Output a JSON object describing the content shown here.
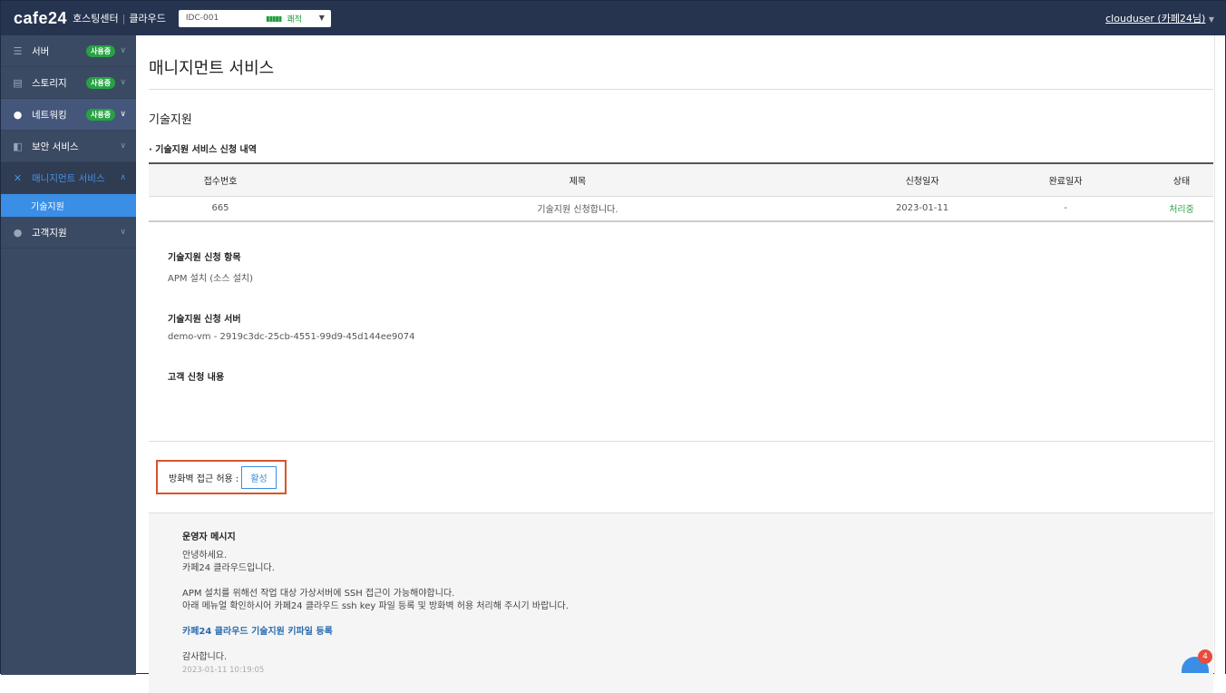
{
  "header": {
    "logo": "cafe24",
    "logo_sub1": "호스팅센터",
    "logo_sub2": "클라우드",
    "idc": {
      "value": "IDC-001",
      "status": "쾌적"
    },
    "user": "clouduser (카페24님)"
  },
  "sidebar": {
    "items": [
      {
        "label": "서버",
        "badge": "사용중",
        "icon": "server-icon"
      },
      {
        "label": "스토리지",
        "badge": "사용중",
        "icon": "storage-icon"
      },
      {
        "label": "네트워킹",
        "badge": "사용중",
        "icon": "globe-icon"
      },
      {
        "label": "보안 서비스",
        "icon": "shield-icon"
      },
      {
        "label": "매니지먼트 서비스",
        "icon": "tools-icon"
      },
      {
        "label": "고객지원",
        "icon": "user-icon"
      }
    ],
    "sub_item": "기술지원"
  },
  "main": {
    "title": "매니지먼트 서비스",
    "section": "기술지원",
    "list_title": "기술지원 서비스 신청 내역",
    "table": {
      "headers": [
        "접수번호",
        "제목",
        "신청일자",
        "완료일자",
        "상태"
      ],
      "rows": [
        [
          "665",
          "기술지원 신청합니다.",
          "2023-01-11",
          "-",
          "처리중"
        ]
      ]
    },
    "detail": {
      "item_label": "기술지원 신청 항목",
      "item_value": "APM 설치 (소스 설치)",
      "server_label": "기술지원 신청 서버",
      "server_value": "demo-vm - 2919c3dc-25cb-4551-99d9-45d144ee9074",
      "content_label": "고객 신청 내용"
    },
    "firewall": {
      "label": "방화벽 접근 허용 :",
      "button": "활성"
    },
    "message": {
      "title": "운영자 메시지",
      "lines": [
        "안녕하세요.",
        "카페24 클라우드입니다.",
        "",
        "APM 설치를 위해선 작업 대상 가상서버에 SSH 접근이 가능해야합니다.",
        "아래 메뉴얼 확인하시어 카페24 클라우드 ssh key 파일 등록 및 방화벽 허용 처리해 주시기 바랍니다."
      ],
      "link": "카페24 클라우드 기술지원 키파일 등록",
      "closing": "감사합니다.",
      "timestamp": "2023-01-11 10:19:05"
    }
  },
  "chat": {
    "count": "4"
  },
  "colors": {
    "status": "#27a243",
    "accent": "#3a8ee6"
  }
}
